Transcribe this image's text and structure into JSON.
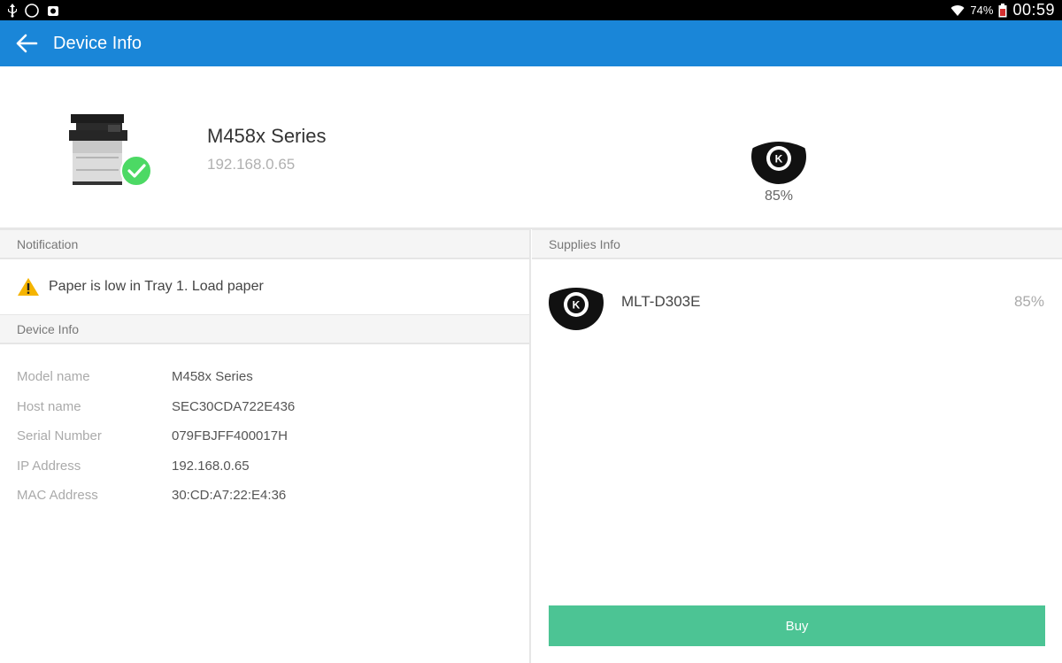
{
  "status_bar": {
    "battery": "74%",
    "time": "00:59"
  },
  "app_bar": {
    "title": "Device Info"
  },
  "device": {
    "name": "M458x Series",
    "ip": "192.168.0.65",
    "status": "ok",
    "toner_level": "85%",
    "toner_color_letter": "K"
  },
  "notification": {
    "header": "Notification",
    "message": "Paper is low in Tray 1. Load paper"
  },
  "device_info": {
    "header": "Device Info",
    "rows": [
      {
        "label": "Model name",
        "value": "M458x Series"
      },
      {
        "label": "Host name",
        "value": "SEC30CDA722E436"
      },
      {
        "label": "Serial Number",
        "value": "079FBJFF400017H"
      },
      {
        "label": "IP Address",
        "value": "192.168.0.65"
      },
      {
        "label": "MAC Address",
        "value": "30:CD:A7:22:E4:36"
      }
    ]
  },
  "supplies": {
    "header": "Supplies Info",
    "items": [
      {
        "name": "MLT-D303E",
        "level": "85%",
        "letter": "K"
      }
    ],
    "buy_label": "Buy"
  },
  "colors": {
    "app_bar": "#1a86d8",
    "buy_button": "#4cc494",
    "status_ok": "#4cd964",
    "warning": "#f5b400"
  }
}
